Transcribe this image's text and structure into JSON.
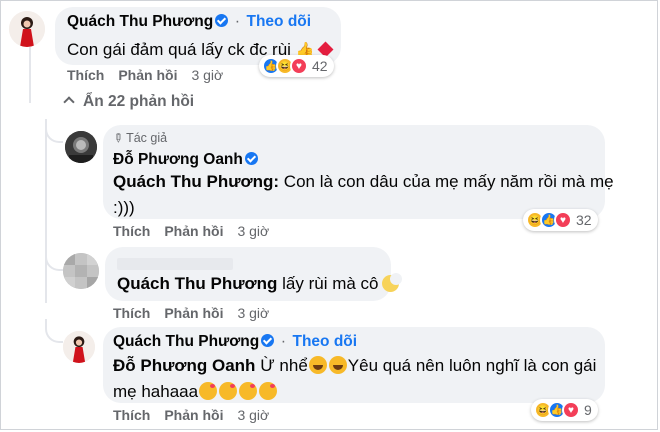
{
  "colors": {
    "bubble": "#f0f2f5",
    "link": "#1877f2",
    "muted": "#65676b",
    "love": "#f33e58",
    "haha": "#f7b928"
  },
  "comments": [
    {
      "author": "Quách Thu Phương",
      "follow": "Theo dõi",
      "separator": "·",
      "text": "Con gái đảm quá lấy ck đc rùi",
      "emoji_icons": [
        "thumbs-up-icon",
        "heart-icon"
      ],
      "actions": {
        "like": "Thích",
        "reply": "Phản hồi",
        "time": "3 giờ"
      },
      "reaction_icons": [
        "like-reaction-icon",
        "haha-reaction-icon",
        "love-reaction-icon"
      ],
      "reaction_count": "42"
    }
  ],
  "hide_replies": "Ẩn 22 phản hồi",
  "replies": [
    {
      "badge": "Tác giả",
      "author": "Đỗ Phương Oanh",
      "mention": "Quách Thu Phương:",
      "text_line1": "Con là con dâu của mẹ mấy năm rồi mà mẹ",
      "text_line2": ":)))",
      "actions": {
        "like": "Thích",
        "reply": "Phản hồi",
        "time": "3 giờ"
      },
      "reaction_count": "32"
    },
    {
      "mention": "Quách Thu Phương",
      "text": "lấy rùi mà cô",
      "actions": {
        "like": "Thích",
        "reply": "Phản hồi",
        "time": "3 giờ"
      }
    },
    {
      "author": "Quách Thu Phương",
      "follow": "Theo dõi",
      "mention": "Đỗ Phương Oanh",
      "text_a": "Ừ nhể",
      "text_b": "Yêu quá nên luôn nghĩ là con gái",
      "text_c": "mẹ hahaaa",
      "actions": {
        "like": "Thích",
        "reply": "Phản hồi",
        "time": "3 giờ"
      },
      "reaction_count": "9"
    }
  ]
}
